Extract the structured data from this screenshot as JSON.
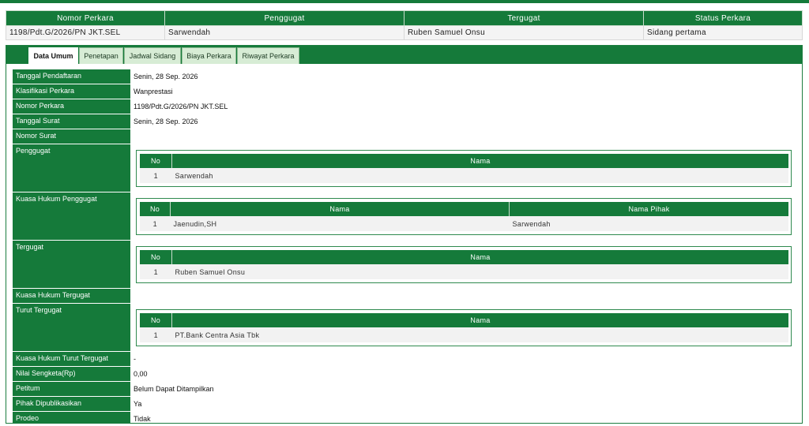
{
  "summary": {
    "headers": [
      "Nomor Perkara",
      "Penggugat",
      "Tergugat",
      "Status Perkara"
    ],
    "row": [
      "1198/Pdt.G/2026/PN JKT.SEL",
      "Sarwendah",
      "Ruben Samuel Onsu",
      "Sidang pertama"
    ]
  },
  "tabs": [
    {
      "label": "Data Umum",
      "active": true
    },
    {
      "label": "Penetapan",
      "active": false
    },
    {
      "label": "Jadwal Sidang",
      "active": false
    },
    {
      "label": "Biaya Perkara",
      "active": false
    },
    {
      "label": "Riwayat Perkara",
      "active": false
    }
  ],
  "fields": {
    "tanggal_pendaftaran": {
      "label": "Tanggal Pendaftaran",
      "value": "Senin, 28 Sep. 2026"
    },
    "klasifikasi": {
      "label": "Klasifikasi Perkara",
      "value": "Wanprestasi"
    },
    "nomor_perkara": {
      "label": "Nomor Perkara",
      "value": "1198/Pdt.G/2026/PN JKT.SEL"
    },
    "tanggal_surat": {
      "label": "Tanggal Surat",
      "value": "Senin, 28 Sep. 2026"
    },
    "nomor_surat": {
      "label": "Nomor Surat",
      "value": ""
    },
    "penggugat": {
      "label": "Penggugat"
    },
    "kuasa_penggugat": {
      "label": "Kuasa Hukum Penggugat"
    },
    "tergugat": {
      "label": "Tergugat"
    },
    "kuasa_tergugat": {
      "label": "Kuasa Hukum Tergugat",
      "value": ""
    },
    "turut_tergugat": {
      "label": "Turut Tergugat"
    },
    "kuasa_turut": {
      "label": "Kuasa Hukum Turut Tergugat",
      "value": "-"
    },
    "nilai_sengketa": {
      "label": "Nilai Sengketa(Rp)",
      "value": "0,00"
    },
    "petitum": {
      "label": "Petitum",
      "value": "Belum Dapat Ditampilkan"
    },
    "dipublikasikan": {
      "label": "Pihak Dipublikasikan",
      "value": "Ya"
    },
    "prodeo": {
      "label": "Prodeo",
      "value": "Tidak"
    }
  },
  "penggugat_table": {
    "headers": [
      "No",
      "Nama"
    ],
    "rows": [
      [
        "1",
        "Sarwendah"
      ]
    ]
  },
  "kuasa_penggugat_table": {
    "headers": [
      "No",
      "Nama",
      "Nama Pihak"
    ],
    "rows": [
      [
        "1",
        "Jaenudin,SH",
        "Sarwendah"
      ]
    ]
  },
  "tergugat_table": {
    "headers": [
      "No",
      "Nama"
    ],
    "rows": [
      [
        "1",
        "Ruben Samuel Onsu"
      ]
    ]
  },
  "turut_tergugat_table": {
    "headers": [
      "No",
      "Nama"
    ],
    "rows": [
      [
        "1",
        "PT.Bank Centra Asia Tbk"
      ]
    ]
  }
}
